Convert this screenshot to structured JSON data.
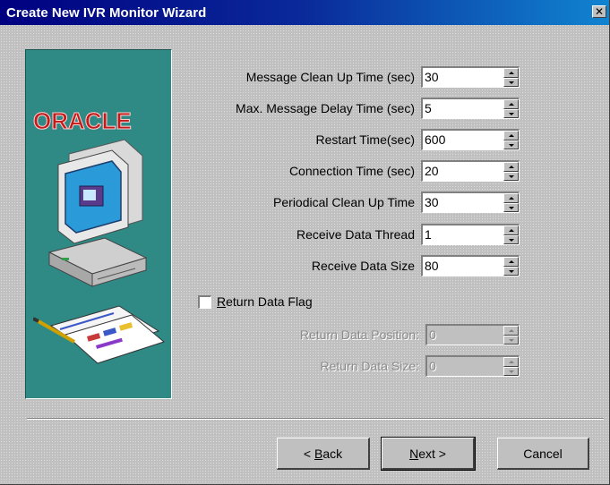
{
  "window": {
    "title": "Create New IVR Monitor Wizard",
    "close_glyph": "✕"
  },
  "side_panel": {
    "brand": "ORACLE",
    "background_color": "#2f8a86",
    "icons": [
      "computer-icon",
      "documents-icon"
    ]
  },
  "fields": [
    {
      "label": "Message Clean Up Time (sec)",
      "value": "30"
    },
    {
      "label": "Max. Message Delay Time (sec)",
      "value": "5"
    },
    {
      "label": "Restart Time(sec)",
      "value": "600"
    },
    {
      "label": "Connection Time (sec)",
      "value": "20"
    },
    {
      "label": "Periodical Clean Up Time",
      "value": "30"
    },
    {
      "label": "Receive Data Thread",
      "value": "1"
    },
    {
      "label": "Receive Data Size",
      "value": "80"
    }
  ],
  "return_data": {
    "checkbox_label_prefix": "R",
    "checkbox_label_rest": "eturn Data Flag",
    "checked": false,
    "position_label": "Return Data Position:",
    "position_value": "0",
    "size_label": "Return Data Size:",
    "size_value": "0"
  },
  "buttons": {
    "back_prefix": "< ",
    "back_mnemonic": "B",
    "back_rest": "ack",
    "next_mnemonic": "N",
    "next_rest": "ext >",
    "cancel": "Cancel"
  },
  "colors": {
    "titlebar_start": "#000080",
    "titlebar_end": "#1084d0",
    "dialog_face": "#c0c0c0",
    "brand_red": "#c11a1a"
  }
}
